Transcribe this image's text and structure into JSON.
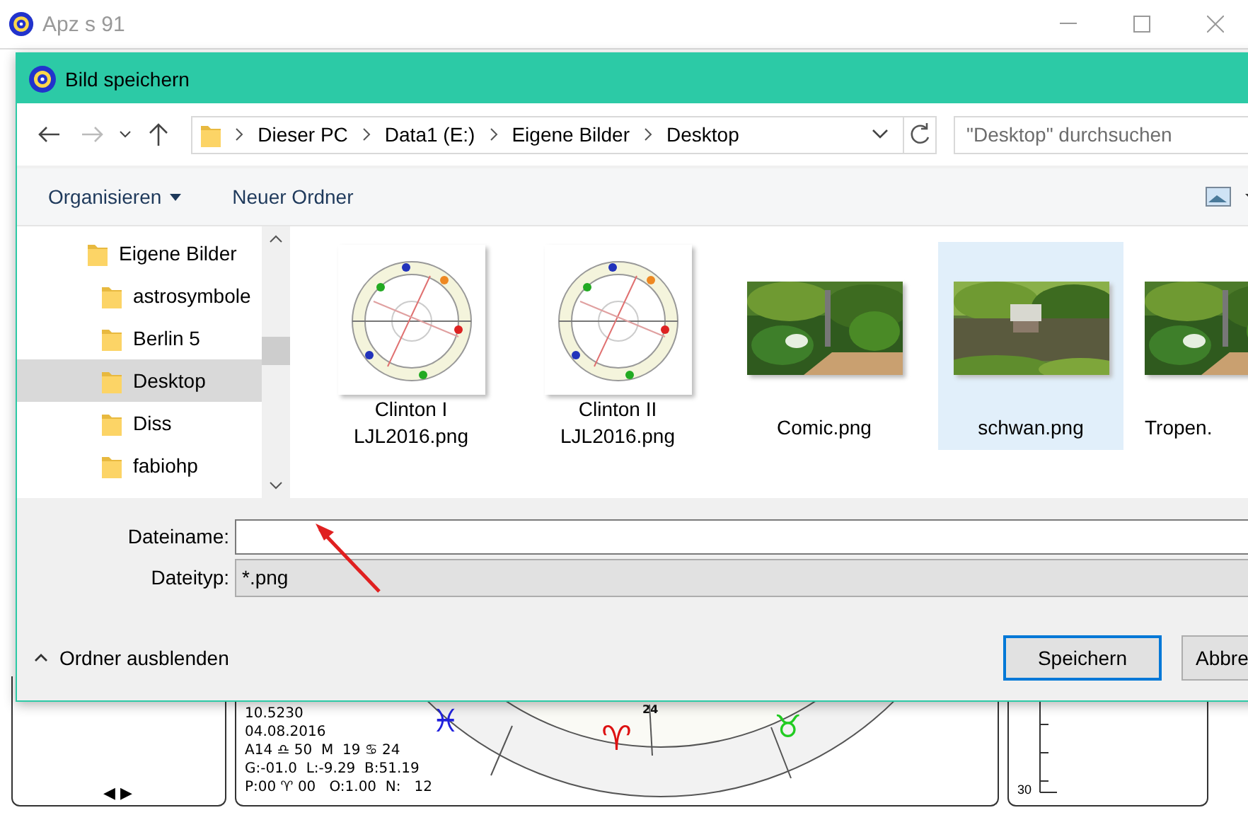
{
  "app_window": {
    "title": "Apz s 91",
    "nav_arrows": [
      "◀",
      "▶"
    ],
    "info_lines": [
      "10.5230",
      "04.08.2016",
      "A14 ♎ 50  M  19 ♋ 24",
      "G:-01.0  L:-9.29  B:51.19",
      "P:00 ♈ 00   O:1.00  N:   12"
    ],
    "wheel_labels": [
      {
        "text": "♓",
        "color": "#2222dd"
      },
      {
        "text": "24",
        "color": "#111111"
      },
      {
        "text": "♈",
        "color": "#dd1111"
      },
      {
        "text": "♉",
        "color": "#22cc22"
      }
    ],
    "scale_label": "30"
  },
  "dialog": {
    "title": "Bild speichern",
    "breadcrumb": [
      "Dieser PC",
      "Data1 (E:)",
      "Eigene Bilder",
      "Desktop"
    ],
    "search": {
      "placeholder": "\"Desktop\" durchsuchen"
    },
    "toolbar": [
      "Organisieren",
      "Neuer Ordner"
    ],
    "tree": [
      {
        "label": "Eigene Bilder",
        "selected": false,
        "children": [
          {
            "label": "astrosymbole",
            "selected": false
          },
          {
            "label": "Berlin 5",
            "selected": false
          },
          {
            "label": "Desktop",
            "selected": true
          },
          {
            "label": "Diss",
            "selected": false
          },
          {
            "label": "fabiohp",
            "selected": false
          }
        ]
      }
    ],
    "files": [
      {
        "kind": "chart",
        "lines": [
          "Clinton I",
          "LJL2016.png"
        ],
        "selected": false
      },
      {
        "kind": "chart",
        "lines": [
          "Clinton II",
          "LJL2016.png"
        ],
        "selected": false
      },
      {
        "lines": [
          "Comic.png"
        ],
        "selected": false
      },
      {
        "lines": [
          "schwan.png"
        ],
        "selected": true
      },
      {
        "lines": [
          "Tropen."
        ],
        "selected": false
      }
    ],
    "filename": {
      "label": "Dateiname:"
    },
    "filetype": {
      "label": "Dateityp:",
      "value": "*.png"
    },
    "toggle": "Ordner ausblenden",
    "buttons": [
      {
        "label": "Speichern",
        "default": true
      },
      {
        "label": "Abbre",
        "default": false
      }
    ]
  }
}
